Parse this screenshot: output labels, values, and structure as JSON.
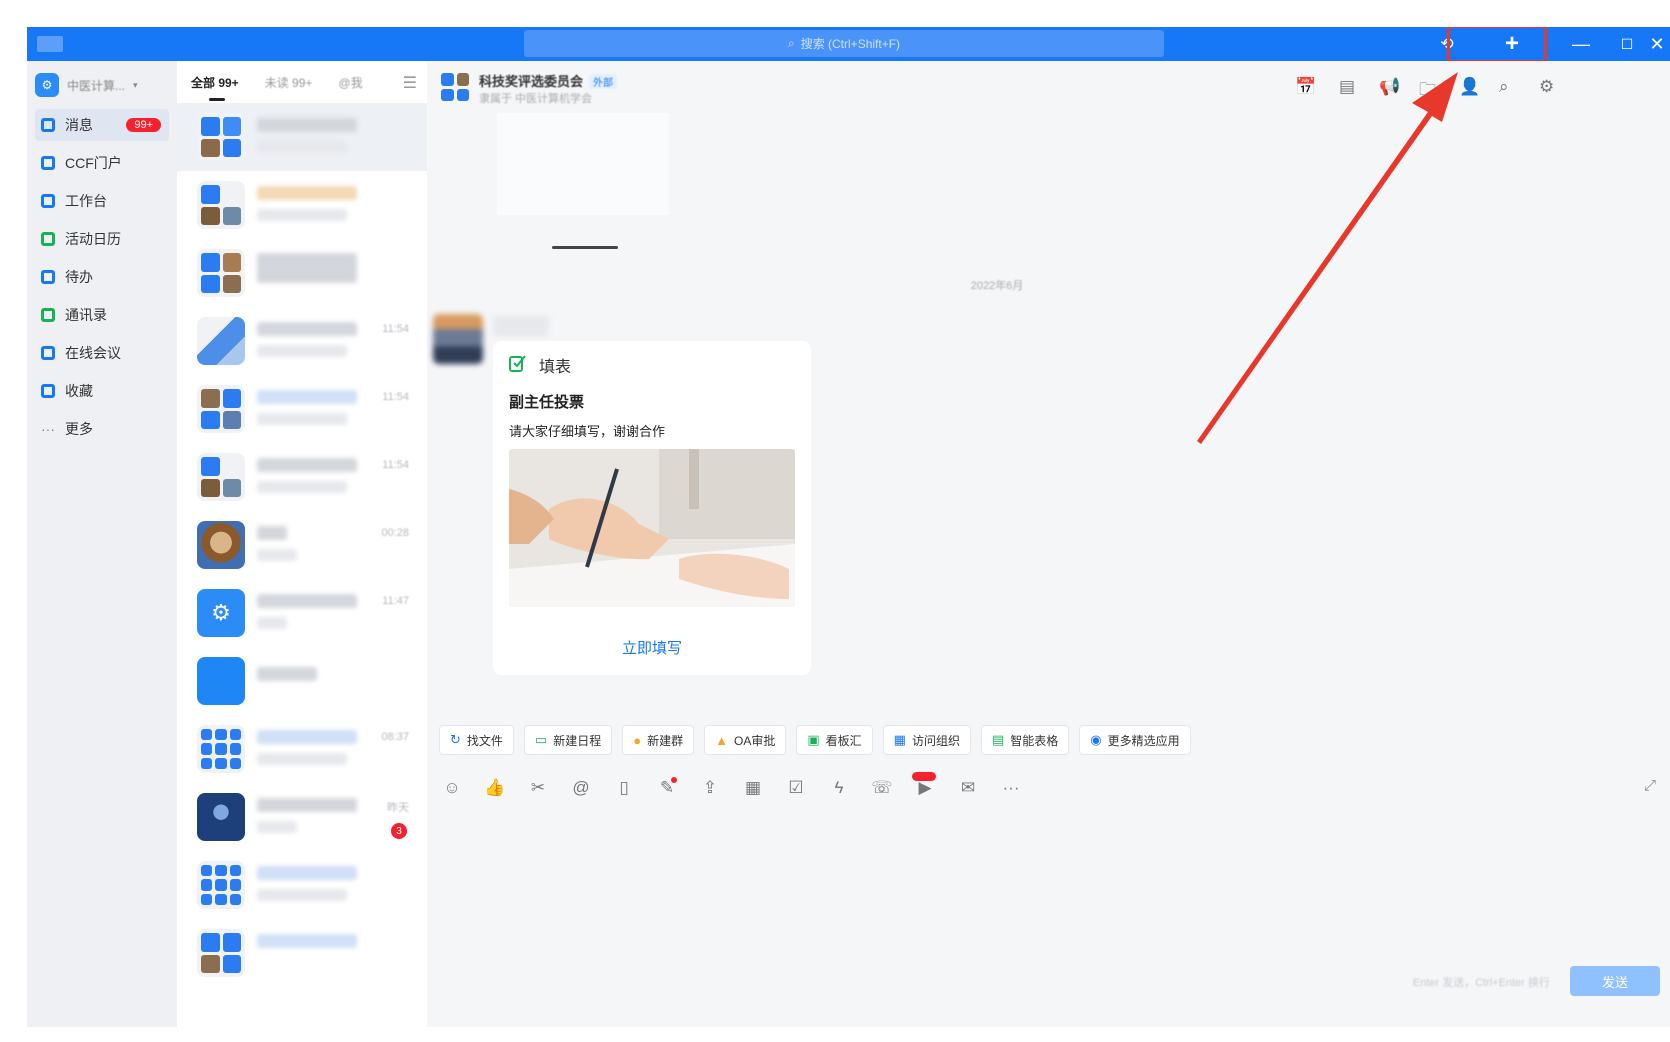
{
  "titlebar": {
    "search_placeholder": "搜索 (Ctrl+Shift+F)",
    "plus_label": "+",
    "minimize_label": "—",
    "maximize_label": "☐",
    "close_label": "✕"
  },
  "leftnav": {
    "org_name": "中医计算...",
    "items": [
      {
        "label": "消息",
        "badge": "99+"
      },
      {
        "label": "CCF门户"
      },
      {
        "label": "工作台"
      },
      {
        "label": "活动日历"
      },
      {
        "label": "待办"
      },
      {
        "label": "通讯录"
      },
      {
        "label": "在线会议"
      },
      {
        "label": "收藏"
      },
      {
        "label": "更多"
      }
    ]
  },
  "convlist": {
    "tabs": [
      {
        "label": "全部 99+"
      },
      {
        "label": "未读 99+"
      },
      {
        "label": "@我"
      }
    ],
    "times": [
      "",
      "",
      "",
      "11:54",
      "11:54",
      "11:54",
      "00:28",
      "11:47",
      "",
      "08:37",
      "昨天",
      "",
      ""
    ],
    "unread_count": "3"
  },
  "chat": {
    "title": "科技奖评选委员会",
    "tag": "外部",
    "subtitle": "隶属于 中医计算机学会",
    "date_divider": "2022年6月",
    "card": {
      "type_label": "填表",
      "title": "副主任投票",
      "description": "请大家仔细填写，谢谢合作",
      "action": "立即填写"
    },
    "quick_actions": [
      {
        "icon": "↻",
        "label": "找文件"
      },
      {
        "label": "新建日程"
      },
      {
        "label": "新建群"
      },
      {
        "label": "OA审批"
      },
      {
        "label": "看板汇"
      },
      {
        "label": "访问组织"
      },
      {
        "label": "智能表格"
      },
      {
        "label": "更多精选应用"
      }
    ],
    "send_hint": "Enter 发送，Ctrl+Enter 换行",
    "send_label": "发送"
  },
  "colors": {
    "brand": "#1677f7",
    "highlight": "#e8372b",
    "badge": "#f5222d"
  }
}
